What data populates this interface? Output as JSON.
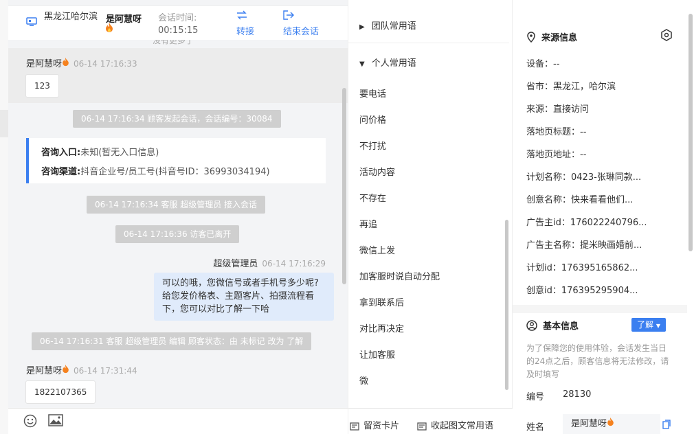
{
  "header": {
    "location": "黑龙江哈尔滨",
    "customer_name": "是阿慧呀",
    "session_time_label": "会话时间:",
    "session_time_value": "00:15:15",
    "transfer_label": "转接",
    "end_label": "结束会话"
  },
  "chat": {
    "faint_top": "没有更多了",
    "messages": [
      {
        "sender": "是阿慧呀",
        "time": "06-14 17:16:33",
        "text": "123"
      },
      {
        "sender": "是阿慧呀",
        "time": "06-14 17:31:44",
        "text": "1822107365"
      }
    ],
    "system": [
      "06-14 17:16:34 顾客发起会话，会话编号：30084",
      "06-14 17:16:34 客服 超级管理员 接入会话",
      "06-14 17:16:36 访客已离开",
      "06-14 17:16:31 客服 超级管理员 编辑 顾客状态：由 未标记 改为 了解"
    ],
    "entry_label": "咨询入口:",
    "entry_value": "未知(暂无入口信息)",
    "channel_label": "咨询渠道:",
    "channel_value": "抖音企业号/员工号(抖音号ID：36993034194)",
    "agent_name": "超级管理员",
    "agent_time": "06-14 17:16:29",
    "agent_text": "可以的哦，您微信号或者手机号多少呢?给您发价格表、主题客片、拍摄流程看下，您可以对比了解一下哈"
  },
  "phrases": {
    "team_title": "团队常用语",
    "personal_title": "个人常用语",
    "items": [
      "要电话",
      "问价格",
      "不打扰",
      "活动内容",
      "不存在",
      "再追",
      "微信上发",
      "加客服时说自动分配",
      "拿到联系后",
      "对比再决定",
      "让加客服",
      "微"
    ],
    "leave_card": "留资卡片",
    "collapse": "收起图文常用语"
  },
  "info": {
    "source_title": "来源信息",
    "rows": [
      "设备：--",
      "省市：黑龙江，哈尔滨",
      "来源：直接访问",
      "落地页标题：--",
      "落地页地址：--",
      "计划名称：0423-张琳同款...",
      "创意名称：快来看看他们...",
      "广告主id：176022240796...",
      "广告主名称：提米映画婚前...",
      "计划id：176395165862...",
      "创意id：176395295904..."
    ],
    "basic_title": "基本信息",
    "learn_label": "了解",
    "notice": "为了保障您的使用体验，会话发生当日的24点之后，顾客信息将无法修改，请及时填写",
    "id_label": "编号",
    "id_value": "28130",
    "name_label": "姓名",
    "name_value": "是阿慧呀"
  },
  "colors": {
    "accent": "#3b7ff0",
    "agent_bubble": "#e0ebfb",
    "system_pill": "#cfcfcf"
  }
}
